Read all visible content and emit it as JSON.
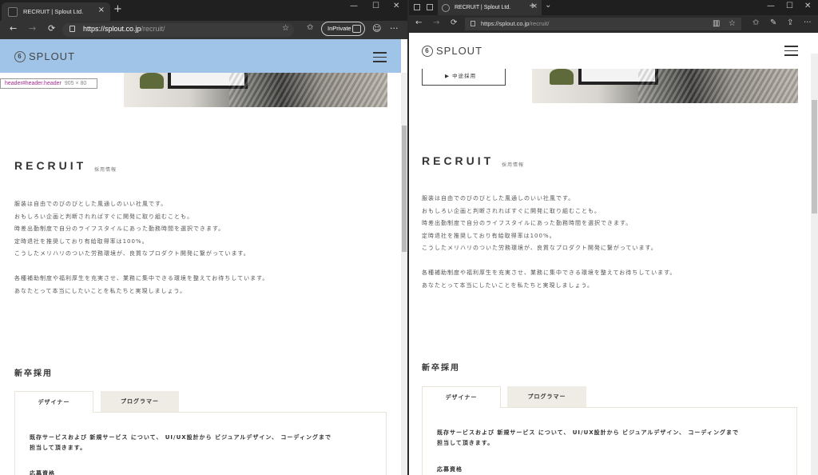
{
  "browser": {
    "tab_title": "RECRUIT | Splout Ltd.",
    "url_host": "https://splout.co.jp",
    "url_path": "/recruit/",
    "inprivate_label": "InPrivate",
    "url_host_short": "https://splout.co.jp",
    "new_tab": "+",
    "close_tab": "×",
    "window_minimize": "—",
    "window_maximize": "☐",
    "window_close": "✕",
    "back": "←",
    "forward": "→",
    "refresh": "⟳",
    "favorite": "☆",
    "favorites": "✩",
    "emoji": "☺",
    "more": "···",
    "reading_view": "▥",
    "notes": "✎",
    "share": "⇪",
    "tabs_chevron": "⌄"
  },
  "devtools_tooltip": {
    "selector": "header#header.header",
    "size": "905 × 80"
  },
  "site": {
    "logo_number": "6",
    "logo_text": "SPLOUT",
    "menu_icon": "hamburger-icon",
    "hero_button": "▶ 中途採用",
    "recruit_title": "RECRUIT",
    "recruit_subtitle": "採用情報",
    "intro": [
      "服装は自由でのびのびとした風通しのいい社風です。",
      "おもしろい企画と判断されればすぐに開発に取り組むことも。",
      "時差出勤制度で自分のライフスタイルにあった勤務時間を選択できます。",
      "定時退社を推奨しており有給取得率は100%。",
      "こうしたメリハリのついた労務環境が、良質なプロダクト開発に繋がっています。",
      "",
      "各種補助制度や福利厚生を充実させ、業務に集中できる環境を整えてお待ちしています。",
      "あなたとって本当にしたいことを私たちと実現しましょう。"
    ],
    "newgrad_title": "新卒採用",
    "tabs": [
      {
        "label": "デザイナー",
        "active": true
      },
      {
        "label": "プログラマー",
        "active": false
      }
    ],
    "panel_text": [
      "既存サービスおよび 新規サービス について、 UI/UX設計から ビジュアルデザイン、 コーディングまで",
      "担当して頂きます。"
    ],
    "requirements_label": "応募資格"
  },
  "colors": {
    "header_highlight": "#a0c4e8",
    "tab_inactive": "#efece5",
    "panel_border": "#e8e4d8"
  }
}
